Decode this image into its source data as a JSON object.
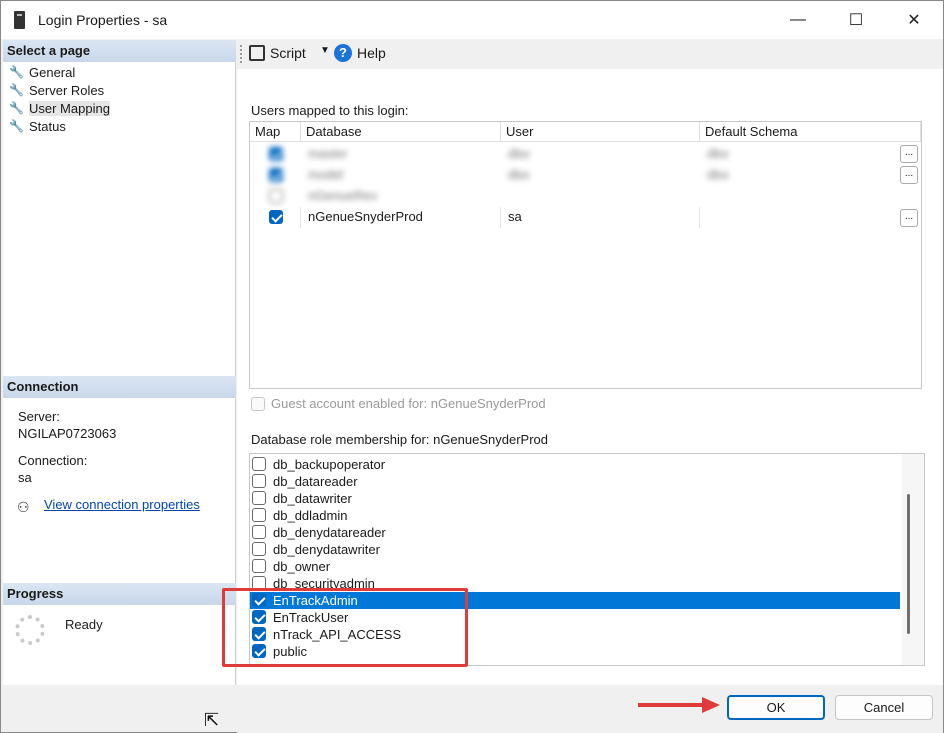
{
  "window": {
    "title": "Login Properties - sa",
    "minimize": "—",
    "maximize": "☐",
    "close": "✕"
  },
  "left": {
    "select_page_header": "Select a page",
    "pages": [
      {
        "label": "General"
      },
      {
        "label": "Server Roles"
      },
      {
        "label": "User Mapping"
      },
      {
        "label": "Status"
      }
    ],
    "connection_header": "Connection",
    "server_label": "Server:",
    "server_value": "NGILAP0723063",
    "connection_label": "Connection:",
    "connection_value": "sa",
    "view_connection_link": "View connection properties",
    "progress_header": "Progress",
    "progress_status": "Ready"
  },
  "toolbar": {
    "script_label": "Script",
    "help_label": "Help"
  },
  "users_section": {
    "label": "Users mapped to this login:",
    "columns": [
      "Map",
      "Database",
      "User",
      "Default Schema"
    ],
    "rows": [
      {
        "map": true,
        "database": "master",
        "user": "dbo",
        "schema": "dbo",
        "blurred": true
      },
      {
        "map": true,
        "database": "model",
        "user": "dbo",
        "schema": "dbo",
        "blurred": true
      },
      {
        "map": false,
        "database": "nGenueRev",
        "user": "",
        "schema": "",
        "blurred": true
      },
      {
        "map": true,
        "database": "nGenueSnyderProd",
        "user": "sa",
        "schema": "",
        "blurred": false
      }
    ],
    "ellipsis": "..."
  },
  "guest": {
    "label": "Guest account enabled for: nGenueSnyderProd",
    "checked": false
  },
  "roles_section": {
    "label": "Database role membership for: nGenueSnyderProd",
    "roles": [
      {
        "name": "db_backupoperator",
        "checked": false
      },
      {
        "name": "db_datareader",
        "checked": false
      },
      {
        "name": "db_datawriter",
        "checked": false
      },
      {
        "name": "db_ddladmin",
        "checked": false
      },
      {
        "name": "db_denydatareader",
        "checked": false
      },
      {
        "name": "db_denydatawriter",
        "checked": false
      },
      {
        "name": "db_owner",
        "checked": false
      },
      {
        "name": "db_securityadmin",
        "checked": false
      },
      {
        "name": "EnTrackAdmin",
        "checked": true,
        "selected": true
      },
      {
        "name": "EnTrackUser",
        "checked": true
      },
      {
        "name": "nTrack_API_ACCESS",
        "checked": true
      },
      {
        "name": "public",
        "checked": true
      }
    ]
  },
  "buttons": {
    "ok": "OK",
    "cancel": "Cancel"
  },
  "colors": {
    "accent": "#0067c0",
    "selection": "#0078d7",
    "annotation": "#e03b3b"
  }
}
